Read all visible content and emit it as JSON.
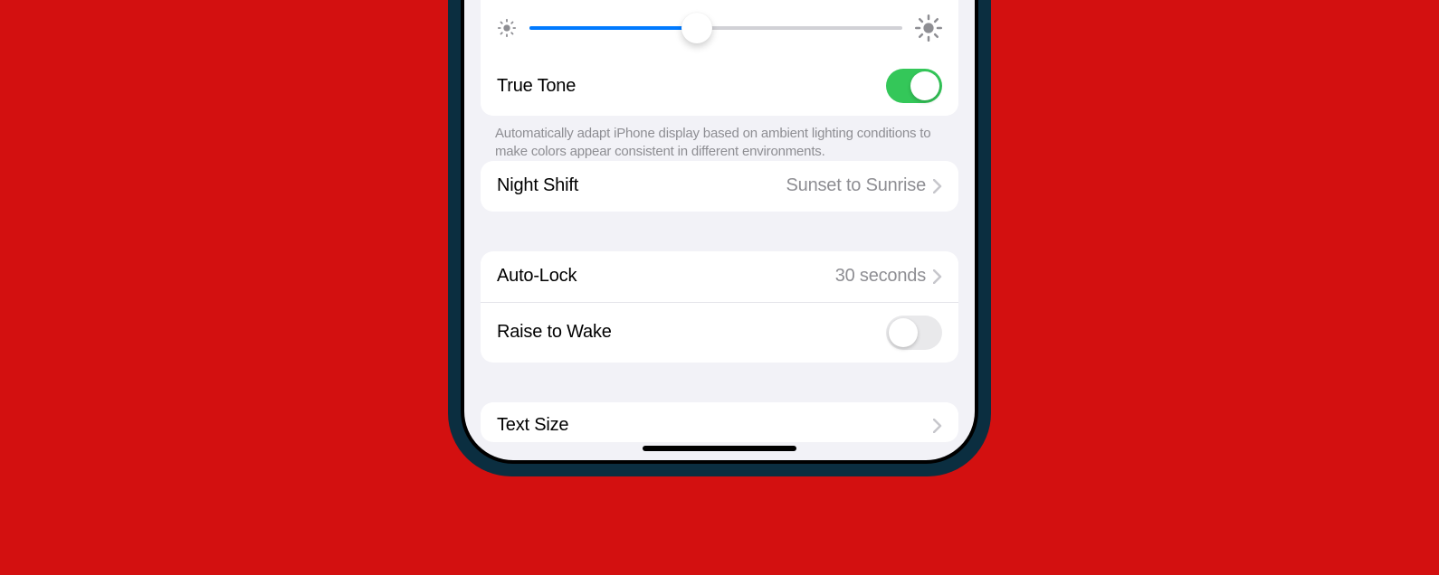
{
  "brightness": {
    "slider_percent": 45
  },
  "true_tone": {
    "label": "True Tone",
    "enabled": true,
    "description": "Automatically adapt iPhone display based on ambient lighting conditions to make colors appear consistent in different environments."
  },
  "night_shift": {
    "label": "Night Shift",
    "value": "Sunset to Sunrise"
  },
  "auto_lock": {
    "label": "Auto-Lock",
    "value": "30 seconds"
  },
  "raise_to_wake": {
    "label": "Raise to Wake",
    "enabled": false
  },
  "text_size": {
    "label": "Text Size"
  }
}
